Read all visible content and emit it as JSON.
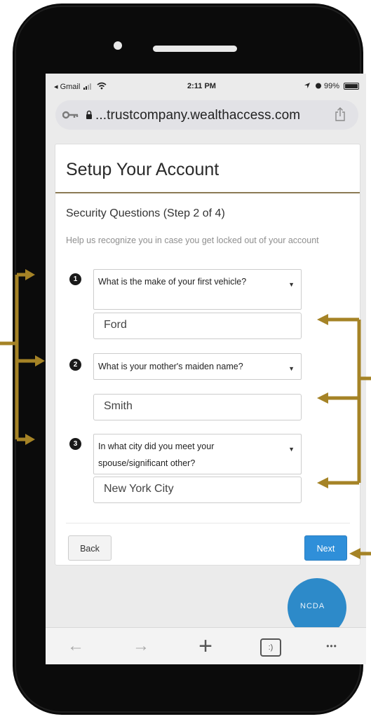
{
  "status_bar": {
    "back_app": "◂ Gmail",
    "time": "2:11 PM",
    "battery": "99%",
    "battery_level": 0.99
  },
  "url_bar": {
    "url": "...trustcompany.wealthaccess.com",
    "icons": [
      "key-icon",
      "lock-icon",
      "share-icon"
    ]
  },
  "page": {
    "title": "Setup Your Account",
    "section_title": "Security Questions (Step 2 of 4)",
    "help_text": "Help us recognize you in case you get locked out of your account",
    "questions": [
      {
        "number": "1",
        "question": "What is the make of your first vehicle?",
        "answer": "Ford"
      },
      {
        "number": "2",
        "question": "What is your mother's maiden name?",
        "answer": "Smith"
      },
      {
        "number": "3",
        "question": "In what city did you meet your spouse/significant other?",
        "answer": "New York City"
      }
    ],
    "back_label": "Back",
    "next_label": "Next"
  },
  "badge_partial_text": "NCDA",
  "toolbar": {
    "back": "←",
    "forward": "→",
    "new_tab": "+",
    "tabs": ":)",
    "more": "•••"
  },
  "colors": {
    "annotation": "#a58326",
    "primary_button": "#2f8fd9",
    "title_rule": "#8b7a54",
    "phone_body": "#0b0b0b"
  }
}
